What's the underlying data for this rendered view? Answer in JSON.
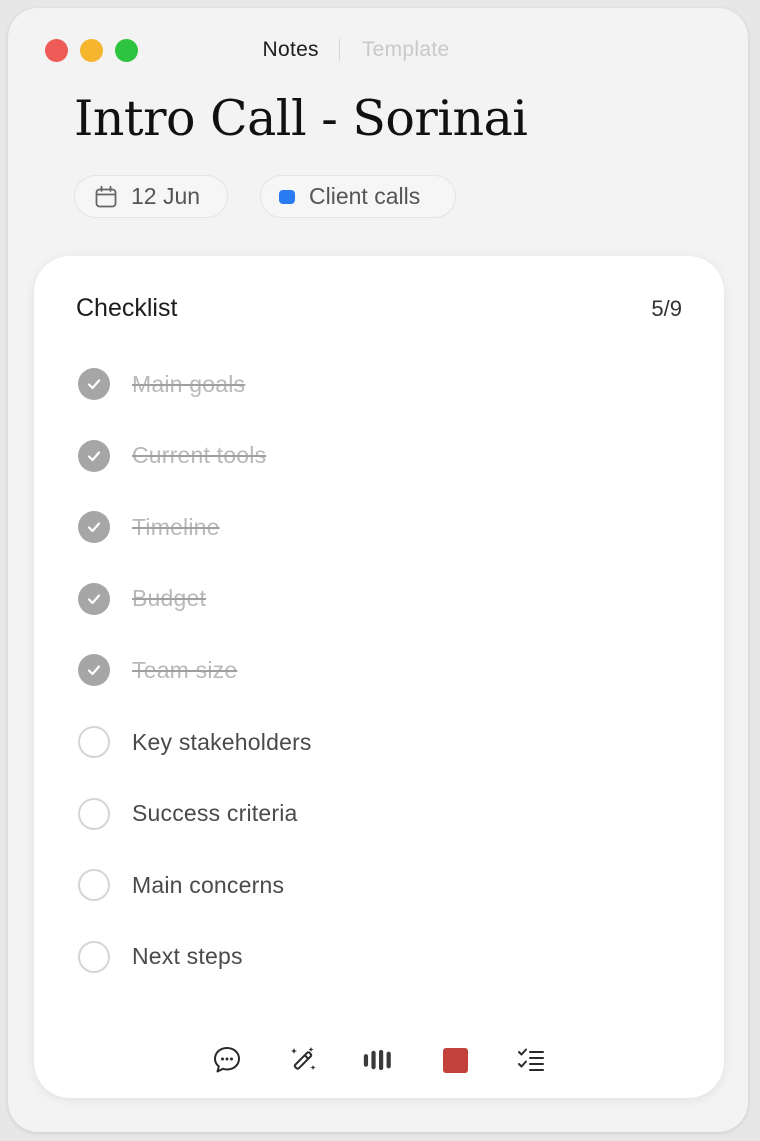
{
  "window": {
    "traffic_lights": [
      {
        "name": "close",
        "color": "#ee5b57"
      },
      {
        "name": "minimize",
        "color": "#f5b52e"
      },
      {
        "name": "zoom",
        "color": "#2fc440"
      }
    ]
  },
  "tabs": {
    "active": "Notes",
    "inactive": "Template"
  },
  "note": {
    "title": "Intro Call - Sorinai",
    "date": "12 Jun",
    "date_icon": "calendar-icon",
    "folder": "Client calls",
    "folder_color": "#2a7bf2"
  },
  "checklist": {
    "title": "Checklist",
    "count": "5/9",
    "items": [
      {
        "label": "Main goals",
        "done": true
      },
      {
        "label": "Current tools",
        "done": true
      },
      {
        "label": "Timeline",
        "done": true
      },
      {
        "label": "Budget",
        "done": true
      },
      {
        "label": "Team size",
        "done": true
      },
      {
        "label": "Key stakeholders",
        "done": false
      },
      {
        "label": "Success criteria",
        "done": false
      },
      {
        "label": "Main concerns",
        "done": false
      },
      {
        "label": "Next steps",
        "done": false
      }
    ]
  },
  "toolbar": {
    "icons": [
      "chat-bubble-icon",
      "magic-wand-icon",
      "audio-bars-icon",
      "stop-recording-icon",
      "checklist-icon"
    ],
    "stop_color": "#c2413a"
  }
}
